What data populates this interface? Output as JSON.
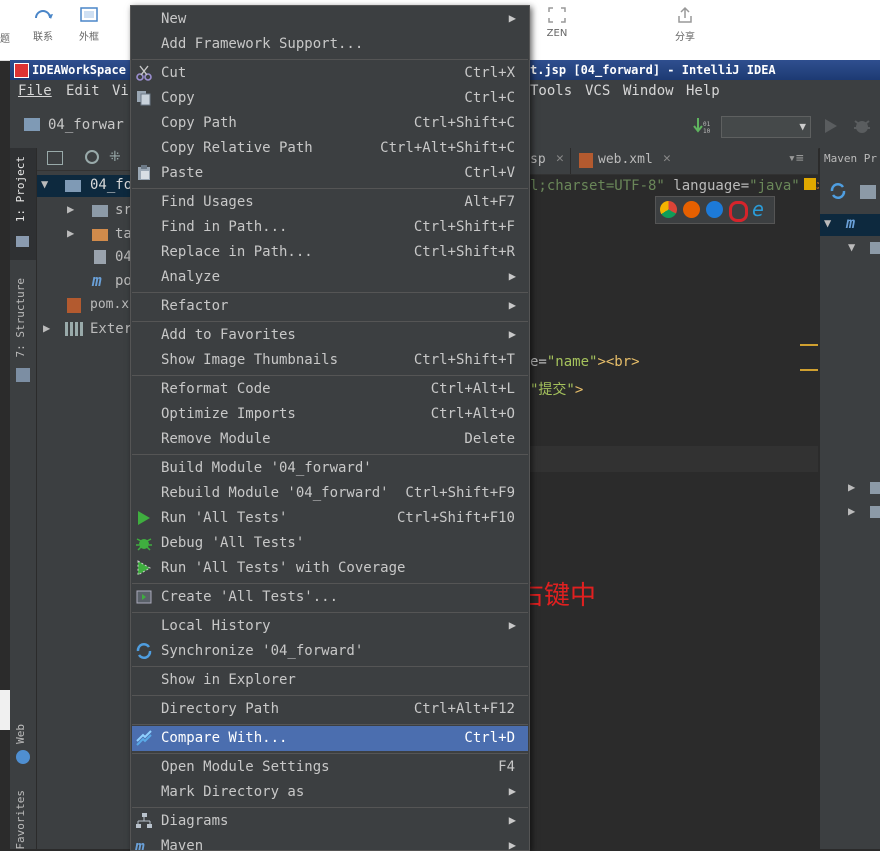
{
  "outer_toolbar": {
    "items": [
      {
        "label": "联系",
        "icon": "refresh-icon"
      },
      {
        "label": "外框",
        "icon": "frame-icon"
      },
      {
        "label": "ZEN",
        "icon": "fullscreen-icon"
      },
      {
        "label": "分享",
        "icon": "share-icon"
      }
    ],
    "left_fragment": "题"
  },
  "window": {
    "title_left": "IDEAWorkSpace",
    "title_right": "t.jsp [04_forward] - IntelliJ IDEA",
    "menu_left": [
      "File",
      "Edit",
      "Vi"
    ],
    "menu_right": [
      "Tools",
      "VCS",
      "Window",
      "Help"
    ]
  },
  "nav": {
    "module": "04_forwar"
  },
  "left_stripe": {
    "tabs": [
      "1: Project",
      "7: Structure",
      "Web",
      "Favorites"
    ]
  },
  "project_tree": {
    "rows": [
      "04_fo",
      "sr",
      "ta",
      "04",
      "po",
      "pom.x",
      "Exter"
    ]
  },
  "editor": {
    "tabs": [
      "sp",
      "web.xml"
    ],
    "code_line1_a": "l;charset=UTF-8\"",
    "code_line1_b": " language=",
    "code_line1_c": "\"java\"",
    "code_line1_d": " %>",
    "code_line2_a": "e=",
    "code_line2_b": "\"name\"",
    "code_line2_c": "><br>",
    "code_line3_a": "\"提交\"",
    "code_line3_b": ">",
    "annotation": "模块右键中"
  },
  "maven": {
    "title": "Maven Pr"
  },
  "context_menu": {
    "items": [
      {
        "label": "New",
        "shortcut": "",
        "submenu": true
      },
      {
        "label": "Add Framework Support...",
        "shortcut": ""
      },
      {
        "label": "Cut",
        "shortcut": "Ctrl+X"
      },
      {
        "label": "Copy",
        "shortcut": "Ctrl+C"
      },
      {
        "label": "Copy Path",
        "shortcut": "Ctrl+Shift+C"
      },
      {
        "label": "Copy Relative Path",
        "shortcut": "Ctrl+Alt+Shift+C"
      },
      {
        "label": "Paste",
        "shortcut": "Ctrl+V"
      },
      {
        "label": "Find Usages",
        "shortcut": "Alt+F7"
      },
      {
        "label": "Find in Path...",
        "shortcut": "Ctrl+Shift+F"
      },
      {
        "label": "Replace in Path...",
        "shortcut": "Ctrl+Shift+R"
      },
      {
        "label": "Analyze",
        "shortcut": "",
        "submenu": true
      },
      {
        "label": "Refactor",
        "shortcut": "",
        "submenu": true
      },
      {
        "label": "Add to Favorites",
        "shortcut": "",
        "submenu": true
      },
      {
        "label": "Show Image Thumbnails",
        "shortcut": "Ctrl+Shift+T"
      },
      {
        "label": "Reformat Code",
        "shortcut": "Ctrl+Alt+L"
      },
      {
        "label": "Optimize Imports",
        "shortcut": "Ctrl+Alt+O"
      },
      {
        "label": "Remove Module",
        "shortcut": "Delete"
      },
      {
        "label": "Build Module '04_forward'",
        "shortcut": ""
      },
      {
        "label": "Rebuild Module '04_forward'",
        "shortcut": "Ctrl+Shift+F9"
      },
      {
        "label": "Run 'All Tests'",
        "shortcut": "Ctrl+Shift+F10"
      },
      {
        "label": "Debug 'All Tests'",
        "shortcut": ""
      },
      {
        "label": "Run 'All Tests' with Coverage",
        "shortcut": ""
      },
      {
        "label": "Create 'All Tests'...",
        "shortcut": ""
      },
      {
        "label": "Local History",
        "shortcut": "",
        "submenu": true
      },
      {
        "label": "Synchronize '04_forward'",
        "shortcut": ""
      },
      {
        "label": "Show in Explorer",
        "shortcut": ""
      },
      {
        "label": "Directory Path",
        "shortcut": "Ctrl+Alt+F12"
      },
      {
        "label": "Compare With...",
        "shortcut": "Ctrl+D",
        "selected": true
      },
      {
        "label": "Open Module Settings",
        "shortcut": "F4"
      },
      {
        "label": "Mark Directory as",
        "shortcut": "",
        "submenu": true
      },
      {
        "label": "Diagrams",
        "shortcut": "",
        "submenu": true
      },
      {
        "label": "Maven",
        "shortcut": "",
        "submenu": true
      }
    ]
  },
  "colors": {
    "menu_bg": "#3c3f41",
    "selection": "#4b6eaf",
    "annotation": "#e02020",
    "editor_bg": "#2b2b2b"
  }
}
